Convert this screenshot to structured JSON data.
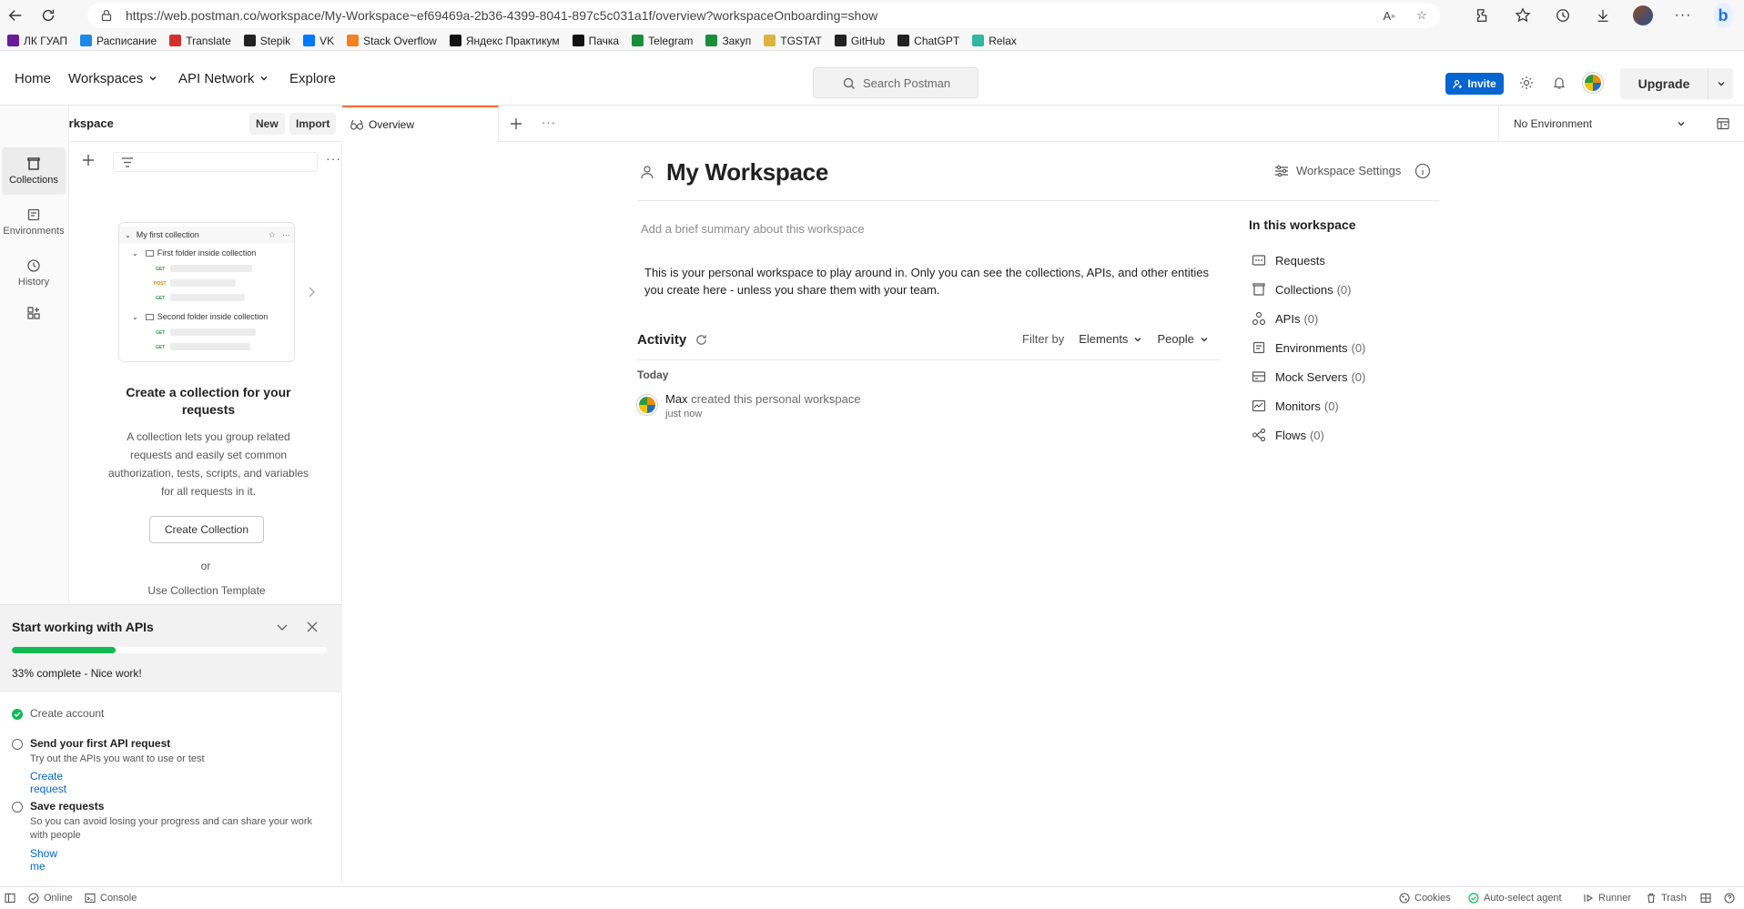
{
  "browser": {
    "url": "https://web.postman.co/workspace/My-Workspace~ef69469a-2b36-4399-8041-897c5c031a1f/overview?workspaceOnboarding=show",
    "bookmarks": [
      {
        "label": "ЛК ГУАП",
        "color": "#6a1b9a"
      },
      {
        "label": "Расписание",
        "color": "#1e88e5"
      },
      {
        "label": "Translate",
        "color": "#d32f2f"
      },
      {
        "label": "Stepik",
        "color": "#222222"
      },
      {
        "label": "VK",
        "color": "#0077ff"
      },
      {
        "label": "Stack Overflow",
        "color": "#f48024"
      },
      {
        "label": "Яндекс Практикум",
        "color": "#111111"
      },
      {
        "label": "Пачка",
        "color": "#111111"
      },
      {
        "label": "Telegram",
        "color": "#1b8e3a"
      },
      {
        "label": "Закуп",
        "color": "#1b8e3a"
      },
      {
        "label": "TGSTAT",
        "color": "#e0b341"
      },
      {
        "label": "GitHub",
        "color": "#222222"
      },
      {
        "label": "ChatGPT",
        "color": "#222222"
      },
      {
        "label": "Relax",
        "color": "#2eb8a0"
      }
    ]
  },
  "header": {
    "nav": {
      "home": "Home",
      "workspaces": "Workspaces",
      "api_network": "API Network",
      "explore": "Explore"
    },
    "search_placeholder": "Search Postman",
    "invite": "Invite",
    "upgrade": "Upgrade"
  },
  "sidebar": {
    "workspace_name": "My Workspace",
    "new_label": "New",
    "import_label": "Import",
    "rail": [
      {
        "label": "Collections",
        "icon": "collections-icon"
      },
      {
        "label": "Environments",
        "icon": "environments-icon"
      },
      {
        "label": "History",
        "icon": "history-icon"
      }
    ],
    "illustration": {
      "collection": "My first collection",
      "folder1": "First folder inside collection",
      "folder2": "Second folder inside collection",
      "get": "GET",
      "post": "POST"
    },
    "empty_title": "Create a collection for your requests",
    "empty_desc": "A collection lets you group related requests and easily set common authorization, tests, scripts, and variables for all requests in it.",
    "create_button": "Create Collection",
    "or": "or",
    "template_link": "Use Collection Template"
  },
  "onboarding": {
    "title": "Start working with APIs",
    "progress_percent": 33,
    "status": "33% complete - Nice work!",
    "tasks": [
      {
        "title": "Create account",
        "done": true
      },
      {
        "title": "Send your first API request",
        "desc": "Try out the APIs you want to use or test",
        "link": "Create request"
      },
      {
        "title": "Save requests",
        "desc": "So you can avoid losing your progress and can share your work with people",
        "link": "Show me"
      }
    ]
  },
  "tabs": {
    "overview": "Overview",
    "environment": "No Environment"
  },
  "overview": {
    "title": "My Workspace",
    "settings": "Workspace Settings",
    "summary_placeholder": "Add a brief summary about this workspace",
    "about": "This is your personal workspace to play around in. Only you can see the collections, APIs, and other entities you create here - unless you share them with your team.",
    "activity": {
      "title": "Activity",
      "filter_by": "Filter by",
      "elements": "Elements",
      "people": "People",
      "today": "Today",
      "user": "Max",
      "action": " created this personal workspace",
      "time": "just now"
    },
    "in_workspace": {
      "title": "In this workspace",
      "items": [
        {
          "label": "Requests",
          "count": ""
        },
        {
          "label": "Collections",
          "count": "(0)"
        },
        {
          "label": "APIs",
          "count": "(0)"
        },
        {
          "label": "Environments",
          "count": "(0)"
        },
        {
          "label": "Mock Servers",
          "count": "(0)"
        },
        {
          "label": "Monitors",
          "count": "(0)"
        },
        {
          "label": "Flows",
          "count": "(0)"
        }
      ]
    }
  },
  "footer": {
    "online": "Online",
    "console": "Console",
    "cookies": "Cookies",
    "auto_select": "Auto-select agent",
    "runner": "Runner",
    "trash": "Trash"
  }
}
